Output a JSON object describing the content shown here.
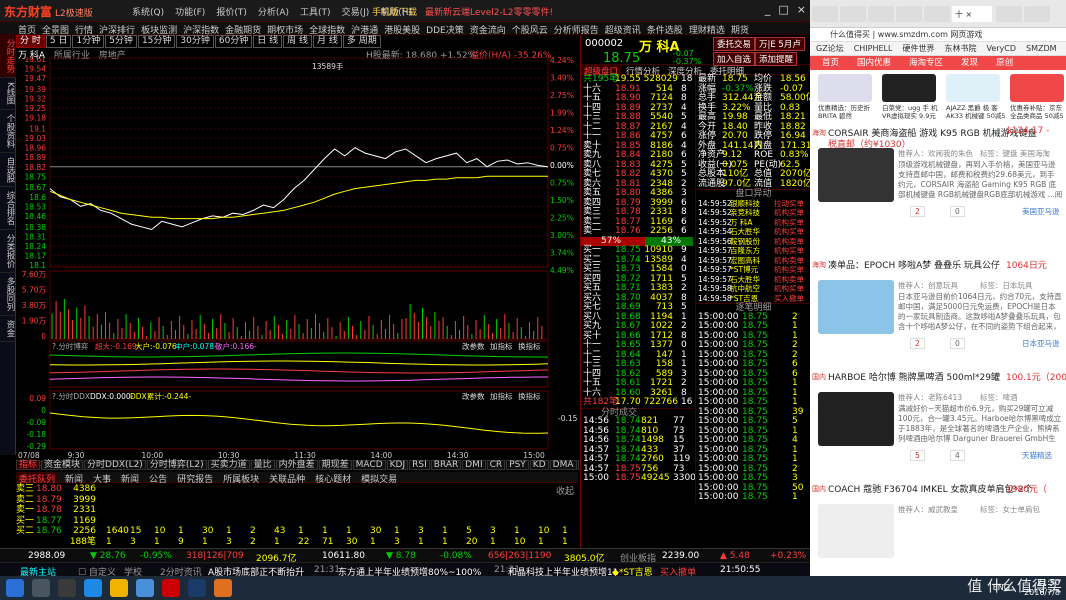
{
  "app": {
    "logo": "东方财富",
    "logo_sub": "L2极速版",
    "menu": [
      "系统(Q)",
      "功能(F)",
      "报价(T)",
      "分析(A)",
      "工具(T)",
      "交易(J)",
      "帮助(H)"
    ],
    "notice_a": "手机版下载",
    "notice_b": "最新新云端Level2-L2零零零件!",
    "nav": [
      "首页",
      "全景图",
      "行情",
      "沪深排行",
      "板块监测",
      "沪深指数",
      "金融期货",
      "期权市场",
      "全球指数",
      "沪港通",
      "港股美股",
      "DDE决策",
      "资金流向",
      "个股风云",
      "分析师报告",
      "超级资讯",
      "条件选股",
      "理财精选",
      "期货"
    ],
    "window_controls": [
      "_",
      "□",
      "×"
    ]
  },
  "leftbar": [
    "分时走势",
    "K线图",
    "个股资料",
    "自选股",
    "综合排名",
    "分类报价",
    "多股同列",
    "资金"
  ],
  "periods": [
    "分 时",
    "5 日",
    "1分钟",
    "5分钟",
    "15分钟",
    "30分钟",
    "60分钟",
    "日 线",
    "周 线",
    "月 线",
    "多 周期"
  ],
  "chart_header": {
    "name": "万 科A",
    "items": [
      "所属行业",
      "房地产"
    ],
    "right": "H股最新: 18.680 +1.52%",
    "prem": "溢价(H/A) -35.26%",
    "hk": "H股",
    "fin": "融资融券"
  },
  "chart_data": {
    "type": "line",
    "title": "万 科A 分时",
    "ylim": [
      18.1,
      19.61
    ],
    "prev_close": 18.82,
    "y_ticks": [
      19.61,
      19.54,
      19.47,
      19.39,
      19.32,
      19.25,
      19.18,
      19.1,
      19.03,
      18.96,
      18.89,
      18.82,
      18.75,
      18.67,
      18.6,
      18.53,
      18.46,
      18.38,
      18.31,
      18.24,
      18.17,
      18.1
    ],
    "y_pct": [
      "4.24%",
      "3.49%",
      "2.75%",
      "1.99%",
      "1.24%",
      "0.75%",
      "0.00%",
      "0.75%",
      "1.50%",
      "2.25%",
      "3.00%",
      "3.74%",
      "4.49%"
    ],
    "x_ticks": [
      "9:30",
      "10:00",
      "10:30",
      "11:30",
      "14:00",
      "14:30",
      "15:00"
    ],
    "date": "07/08",
    "series": [
      {
        "name": "价格",
        "color": "#ffffff",
        "values": [
          18.66,
          18.6,
          18.58,
          18.53,
          18.55,
          18.5,
          18.48,
          18.44,
          18.4,
          18.38,
          18.36,
          18.42,
          18.4,
          18.38,
          18.41,
          18.44,
          18.46,
          18.45,
          18.48,
          18.47,
          18.5,
          18.54,
          18.52,
          18.58,
          18.66,
          18.72,
          18.8,
          18.88,
          18.95,
          18.9,
          18.96,
          18.92,
          18.9,
          18.88,
          18.93,
          18.95,
          18.9,
          18.85,
          18.88,
          18.9,
          18.92,
          18.85,
          18.88,
          18.82,
          18.86,
          18.87,
          18.84,
          18.85,
          18.83,
          18.82
        ]
      },
      {
        "name": "均价",
        "color": "#ffff00",
        "values": [
          18.64,
          18.61,
          18.58,
          18.56,
          18.54,
          18.52,
          18.5,
          18.48,
          18.47,
          18.46,
          18.45,
          18.45,
          18.44,
          18.44,
          18.44,
          18.44,
          18.44,
          18.45,
          18.45,
          18.46,
          18.47,
          18.48,
          18.49,
          18.5,
          18.52,
          18.54,
          18.56,
          18.59,
          18.62,
          18.64,
          18.66,
          18.67,
          18.68,
          18.69,
          18.7,
          18.71,
          18.72,
          18.72,
          18.73,
          18.73,
          18.74,
          18.74,
          18.74,
          18.75,
          18.75,
          18.75,
          18.75,
          18.75,
          18.75,
          18.75
        ]
      }
    ],
    "volume_label": "13589手",
    "vol_ticks": [
      "7.60万",
      "5.70万",
      "3.80万",
      "1.90万",
      "0"
    ],
    "fund_label": "?.分时博弈",
    "fund_items": [
      "超大:-0.169-",
      "大户:-0.076-",
      "中户:0.078-",
      "散户:0.166-"
    ],
    "fund_btns": [
      "改参数",
      "加指标",
      "换指标"
    ],
    "ddx_label": "?.分时DDX",
    "ddx_items": [
      "DDX:0.000-",
      "DDX累计:-0.244-"
    ],
    "ddx_ticks": [
      "0.09",
      "0",
      "-0.09",
      "-0.18",
      "-0.29"
    ],
    "ddx_extra": "-0.15"
  },
  "indicators": [
    "指标",
    "资金模块",
    "分时DDX(L2)",
    "分时博弈(L2)",
    "买卖力道",
    "量比",
    "内外盘差",
    "期现差",
    "MACD",
    "KDJ",
    "RSI",
    "BRAR",
    "DMI",
    "CR",
    "PSY",
    "KD",
    "DMA",
    "TRIX",
    "买卖量",
    "模板"
  ],
  "bottom_tabs": [
    "委托队列",
    "新闻",
    "大事",
    "新闻",
    "公告",
    "研究报告",
    "所属板块",
    "关联品种",
    "核心题材",
    "模拟交易"
  ],
  "queue_label": "收起",
  "queue_rows": [
    {
      "k": "卖三",
      "p": "18.80",
      "v": "4386",
      "nums": []
    },
    {
      "k": "卖二",
      "p": "18.79",
      "v": "3999",
      "nums": []
    },
    {
      "k": "卖一",
      "p": "18.78",
      "v": "2331",
      "nums": []
    },
    {
      "k": "买一",
      "p": "18.77",
      "v": "1169",
      "nums": []
    },
    {
      "k": "买二",
      "p": "18.76",
      "v": "2256",
      "nums": [
        "1640",
        "15",
        "10",
        "1",
        "30",
        "1",
        "2",
        "43",
        "1",
        "1",
        "1",
        "30",
        "1",
        "3",
        "1",
        "5",
        "3",
        "1",
        "10",
        "1"
      ]
    },
    {
      "k": "",
      "p": "",
      "v": "188笔",
      "nums": [
        "1",
        "3",
        "1",
        "9",
        "1",
        "3",
        "2",
        "1",
        "22",
        "71",
        "30",
        "1",
        "3",
        "1",
        "1",
        "20",
        "1",
        "10",
        "1",
        "1"
      ]
    }
  ],
  "right": {
    "code": "000002",
    "name": "万 科A",
    "price": "18.75",
    "chg": "-0.07",
    "chgpct": "-0.37%",
    "btns": [
      "委托交易",
      "万|E 5月卢",
      "加入自选",
      "添加提醒"
    ],
    "tabs": [
      "超级盘口",
      "行情分析",
      "深度分析",
      "委托明细"
    ],
    "sell_header": "共195笔",
    "sell_total": "19.55 528029",
    "sell_n": "18",
    "sells": [
      [
        "十六",
        "18.91",
        "514",
        "8"
      ],
      [
        "十五",
        "18.90",
        "7124",
        "8"
      ],
      [
        "十四",
        "18.89",
        "2737",
        "4"
      ],
      [
        "十三",
        "18.88",
        "5540",
        "5"
      ],
      [
        "十二",
        "18.87",
        "2167",
        "4"
      ],
      [
        "十一",
        "18.86",
        "4757",
        "6"
      ],
      [
        "卖十",
        "18.85",
        "8186",
        "4"
      ],
      [
        "卖九",
        "18.84",
        "2180",
        "6"
      ],
      [
        "卖八",
        "18.83",
        "4275",
        "5"
      ],
      [
        "卖七",
        "18.82",
        "4370",
        "5"
      ],
      [
        "卖六",
        "18.81",
        "2348",
        "2"
      ],
      [
        "卖五",
        "18.80",
        "4386",
        "3"
      ],
      [
        "卖四",
        "18.79",
        "3999",
        "6"
      ],
      [
        "卖三",
        "18.78",
        "2331",
        "8"
      ],
      [
        "卖二",
        "18.77",
        "1169",
        "6"
      ],
      [
        "卖一",
        "18.76",
        "2256",
        "6"
      ]
    ],
    "ratio_l": "57%",
    "ratio_r": "43%",
    "buys": [
      [
        "买一",
        "18.75",
        "10910",
        "9"
      ],
      [
        "买二",
        "18.74",
        "13589",
        "4"
      ],
      [
        "买三",
        "18.73",
        "1584",
        "0"
      ],
      [
        "买四",
        "18.72",
        "1711",
        "5"
      ],
      [
        "买五",
        "18.71",
        "1383",
        "2"
      ],
      [
        "买六",
        "18.70",
        "4037",
        "8"
      ],
      [
        "买七",
        "18.69",
        "713",
        "5"
      ],
      [
        "买八",
        "18.68",
        "1194",
        "1"
      ],
      [
        "买九",
        "18.67",
        "1022",
        "2"
      ],
      [
        "买十",
        "18.66",
        "1712",
        "8"
      ],
      [
        "十一",
        "18.65",
        "1377",
        "0"
      ],
      [
        "十二",
        "18.64",
        "147",
        "1"
      ],
      [
        "十三",
        "18.63",
        "158",
        "1"
      ],
      [
        "十四",
        "18.62",
        "589",
        "3"
      ],
      [
        "十五",
        "18.61",
        "1721",
        "2"
      ],
      [
        "十六",
        "18.60",
        "3261",
        "8"
      ]
    ],
    "buy_footer": "共182笔",
    "buy_total": "17.70 722766",
    "buy_n": "16",
    "stats": [
      [
        "最新",
        "18.75",
        "均价",
        "18.56"
      ],
      [
        "涨幅",
        "-0.37%",
        "涨跌",
        "-0.07"
      ],
      [
        "总手",
        "312.44万",
        "金额",
        "58.00亿"
      ],
      [
        "换手",
        "3.22%",
        "量比",
        "0.83"
      ],
      [
        "最高",
        "19.98",
        "最低",
        "18.21"
      ],
      [
        "今开",
        "18.40",
        "昨收",
        "18.82"
      ],
      [
        "涨停",
        "20.70",
        "跌停",
        "16.94"
      ],
      [
        "外盘",
        "141.14万",
        "内盘",
        "171.31万"
      ],
      [
        "净资产",
        "9.12",
        "ROE",
        "0.83%"
      ],
      [
        "收益(一)",
        "0.075",
        "PE(动)",
        "62.5"
      ],
      [
        "总股本",
        "110亿",
        "总值",
        "2070亿"
      ],
      [
        "流通股",
        "97.0亿",
        "流值",
        "1820亿"
      ]
    ],
    "pk_header": "盘口异动",
    "pk": [
      [
        "14:59:52",
        "银顺科技",
        "拉动买单"
      ],
      [
        "14:59:52",
        "亲竞科技",
        "机构买单"
      ],
      [
        "14:59:52",
        "万 科A",
        "机构买单"
      ],
      [
        "14:59:54",
        "石大胜华",
        "机构买单"
      ],
      [
        "14:59:56",
        "鞍钢股份",
        "机构卖单"
      ],
      [
        "14:59:57",
        "百隆东方",
        "机构买单"
      ],
      [
        "14:59:57",
        "宏图高科",
        "机构卖单"
      ],
      [
        "14:59:57",
        "*ST博元",
        "机构买单"
      ],
      [
        "14:59:57",
        "石大胜华",
        "机构卖单"
      ],
      [
        "14:59:58",
        "杭中航空",
        "机构买单"
      ],
      [
        "14:59:58",
        "*ST吉恩",
        "买入撤单"
      ]
    ],
    "zb_header": "逐笔明细",
    "zb": [
      [
        "15:00:00",
        "18.75",
        "2"
      ],
      [
        "15:00:00",
        "18.75",
        "1"
      ],
      [
        "15:00:00",
        "18.75",
        "1"
      ],
      [
        "15:00:00",
        "18.75",
        "2"
      ],
      [
        "15:00:00",
        "18.75",
        "2"
      ],
      [
        "15:00:00",
        "18.75",
        "6"
      ],
      [
        "15:00:00",
        "18.75",
        "6"
      ],
      [
        "15:00:00",
        "18.75",
        "1"
      ],
      [
        "15:00:00",
        "18.75",
        "1"
      ],
      [
        "15:00:00",
        "18.75",
        "1"
      ],
      [
        "15:00:00",
        "18.75",
        "39"
      ],
      [
        "15:00:00",
        "18.75",
        "5"
      ],
      [
        "15:00:00",
        "18.75",
        "1"
      ],
      [
        "15:00:00",
        "18.75",
        "4"
      ],
      [
        "15:00:00",
        "18.75",
        "1"
      ],
      [
        "15:00:00",
        "18.75",
        "1"
      ],
      [
        "15:00:00",
        "18.75",
        "2"
      ],
      [
        "15:00:00",
        "18.75",
        "3"
      ],
      [
        "15:00:00",
        "18.75",
        "50"
      ],
      [
        "15:00:00",
        "18.75",
        "1"
      ]
    ],
    "fs_header": "分时成交",
    "fs": [
      [
        "14:56",
        "18.74",
        "821",
        "77"
      ],
      [
        "14:56",
        "18.74",
        "810",
        "73"
      ],
      [
        "14:56",
        "18.74",
        "1498",
        "15"
      ],
      [
        "14:57",
        "18.74",
        "433",
        "37"
      ],
      [
        "14:57",
        "18.74",
        "2760",
        "119"
      ],
      [
        "14:57",
        "18.75",
        "756",
        "73"
      ],
      [
        "15:00",
        "18.75",
        "49245",
        "3300"
      ]
    ]
  },
  "statusbar": [
    [
      "2988.09",
      "wht"
    ],
    [
      "▼ 28.76",
      "grn"
    ],
    [
      "-0.95%",
      "grn"
    ],
    [
      "318|126|709",
      "red"
    ],
    [
      "2096.7亿",
      "yel"
    ],
    [
      "10611.80",
      "wht"
    ],
    [
      "▼ 8.78",
      "grn"
    ],
    [
      "-0.08%",
      "grn"
    ],
    [
      "656|263|1190",
      "red"
    ],
    [
      "3805.0亿",
      "yel"
    ],
    [
      "创业板指",
      "gry"
    ],
    [
      "2239.00",
      "wht"
    ],
    [
      "▲ 5.48",
      "red"
    ],
    [
      "+0.23%",
      "red"
    ]
  ],
  "ticker": [
    [
      "最新主站",
      "cyn"
    ],
    [
      "☐ 自定义",
      "gry"
    ],
    [
      "学校",
      "gry"
    ],
    [
      "2分时资讯",
      "gry"
    ],
    [
      "A股市场底部正不断抬升",
      "wht"
    ],
    [
      "21:31",
      "gry"
    ],
    [
      "东方通上半年业绩预增80%~100%",
      "wht"
    ],
    [
      "21:31",
      "gry"
    ],
    [
      "和晶科技上半年业绩预增11",
      "wht"
    ],
    [
      "◆*ST吉恩",
      "yel"
    ],
    [
      "买入撤单",
      "red"
    ],
    [
      "21:50:55",
      "wht"
    ]
  ],
  "browser": {
    "tab_label": "十 ×",
    "url": "什么值得买 | www.smzdm.com 网页游戏",
    "bookmarks": [
      "GZ论坛",
      "CHIPHELL",
      "硬件世界",
      "东林书院",
      "VeryCD",
      "SMZDM"
    ],
    "site_nav": [
      "首页",
      "国内优惠",
      "海淘专区",
      "发现",
      "原创"
    ],
    "tops": [
      {
        "t": "优惠精选：历史折 BRITA 碧然 ¥99+11.76元起",
        "p": ""
      },
      {
        "t": "白菜党：ugg 手 机 VR虚拟现实 9.9元包邮",
        "p": ""
      },
      {
        "t": "AJAZZ 黑爵 极 客 AK33 机械键 50减5",
        "p": ""
      },
      {
        "t": "优惠券补贴：京东 全品类商品 50减5",
        "p": ""
      }
    ],
    "items": [
      {
        "tag": "海淘",
        "title": "CORSAIR 美商海盗船 游戏 K95 RGB 机械游戏键盘",
        "price": "$124.17 -",
        "price2": "税直邮（约¥1030）",
        "by": "推荐人：欢闹我的朱色",
        "cat": "标签：键盘 美国海淘",
        "desc": "顶级游戏机械键盘，再到入手价格，美国亚马逊 支持直邮中国，邮费和税费约29.68美元，到手 约元，CORSAIR 海盗船 Gaming K95 RGB 底部机械键盘 RGB机械键盘RGB底部机械游戏 ...阅读全文",
        "mall": "美国亚马逊",
        "likes": "2",
        "comments": "0"
      },
      {
        "tag": "海淘",
        "title": "凑单品：EPOCH 哆啦A梦 叠叠乐 玩具公仔",
        "price": "1064日元",
        "by": "推荐人：创意玩具",
        "cat": "标签：日本玩具",
        "desc": "日本亚马逊目前价1064日元，约合70元，支持直邮中国，满足5000日元免运费，EPOCH是日本的一家玩具制造商。这款哆啦A梦叠叠乐玩具，包含十个哆啦A梦公仔，在不同的姿势下组合起来，带来... ...阅读全文",
        "mall": "日本亚马逊",
        "likes": "2",
        "comments": "0"
      },
      {
        "tag": "国内",
        "title": "HARBOE 哈尔博 熊牌黑啤酒 500ml*29罐",
        "price": "100.1元（200.1-",
        "by": "推荐人：老陈6413",
        "cat": "标签：啤酒",
        "desc": "满减好价~天猫超市价6.9元，购买29罐可立减100元，合一罐3.45元。Harboe哈尔博黑啤成立于1883年，是全球著名的啤酒生产企业，熊牌系列啤酒由哈尔博 Darguner Brauerei GmbH生产，优惠产品...",
        "mall": "天猫精选",
        "likes": "5",
        "comments": "4"
      },
      {
        "tag": "国内",
        "title": "COACH 蔻驰 F36704 IMKEL 女款真皮单肩包*2个",
        "price": "1980元（",
        "by": "推荐人：威武教皇",
        "cat": "标签：女士单肩包",
        "desc": "",
        "mall": "",
        "likes": "",
        "comments": ""
      }
    ]
  },
  "taskbar": {
    "time": "21:50",
    "date": "2016/7/8",
    "lang": "ENG",
    "watermark": "值 什么值得买"
  }
}
